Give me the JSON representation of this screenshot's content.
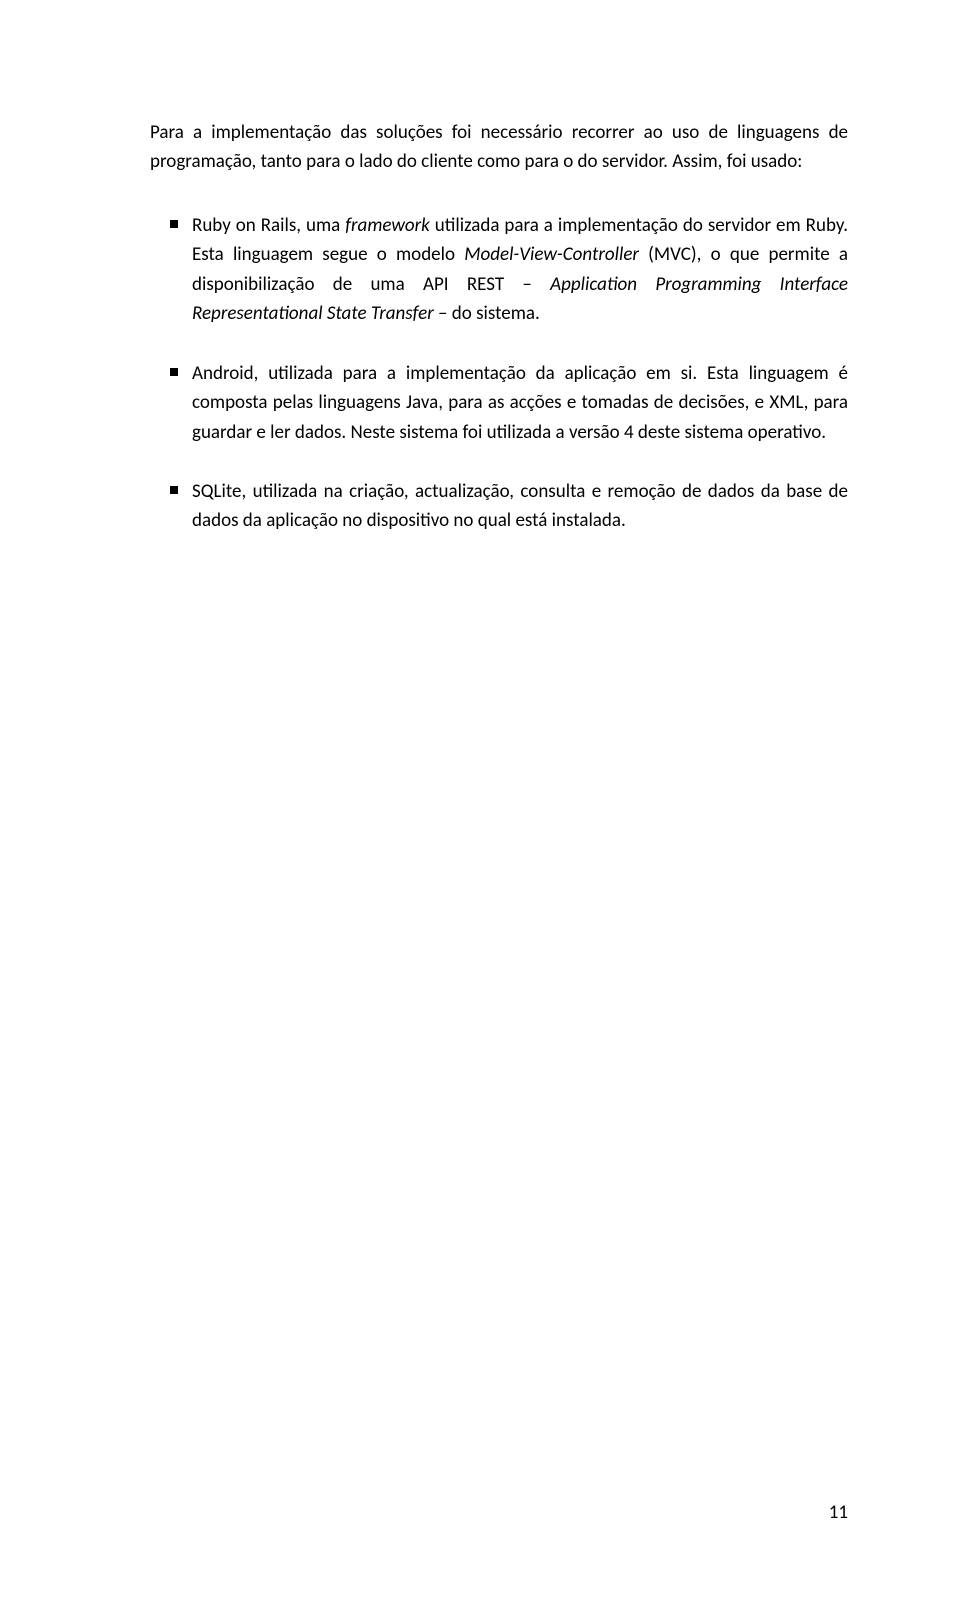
{
  "intro": "Para a implementação das soluções foi necessário recorrer ao uso de linguagens de programação, tanto para o lado do cliente como para o do servidor. Assim, foi usado:",
  "bullets": [
    {
      "pre": "Ruby on Rails, uma ",
      "em1": "framework",
      "mid1": " utilizada para a implementação do servidor em Ruby. Esta linguagem segue o modelo ",
      "em2": "Model-View-Controller",
      "mid2": " (MVC), o que permite a disponibilização de uma API REST – ",
      "em3": "Application Programming Interface Representational State Transfer",
      "post": " – do sistema."
    },
    {
      "text": "Android, utilizada para a implementação da aplicação em si. Esta linguagem é composta pelas linguagens Java, para as acções e tomadas de decisões, e XML, para guardar e ler dados. Neste sistema foi utilizada a versão 4 deste sistema operativo."
    },
    {
      "text": "SQLite, utilizada na criação, actualização, consulta e remoção de dados da base de dados da aplicação no dispositivo no qual está instalada."
    }
  ],
  "page_number": "11"
}
